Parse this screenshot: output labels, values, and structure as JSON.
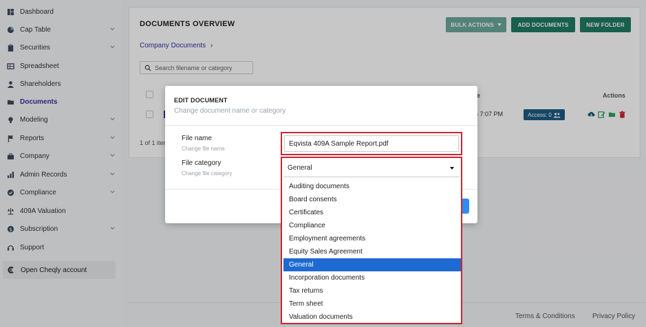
{
  "sidebar": {
    "items": [
      {
        "label": "Dashboard",
        "icon": "dashboard-icon"
      },
      {
        "label": "Cap Table",
        "icon": "pie-chart-icon"
      },
      {
        "label": "Securities",
        "icon": "clipboard-icon"
      },
      {
        "label": "Spreadsheet",
        "icon": "spreadsheet-icon"
      },
      {
        "label": "Shareholders",
        "icon": "user-icon"
      },
      {
        "label": "Documents",
        "icon": "folder-icon"
      },
      {
        "label": "Modeling",
        "icon": "bulb-icon"
      },
      {
        "label": "Reports",
        "icon": "flag-icon"
      },
      {
        "label": "Company",
        "icon": "briefcase-icon"
      },
      {
        "label": "Admin Records",
        "icon": "chart-icon"
      },
      {
        "label": "Compliance",
        "icon": "check-circle-icon"
      },
      {
        "label": "409A Valuation",
        "icon": "scale-icon"
      },
      {
        "label": "Subscription",
        "icon": "dollar-icon"
      },
      {
        "label": "Support",
        "icon": "headset-icon"
      }
    ],
    "cheqly_label": "Open Cheqly account"
  },
  "card": {
    "title": "DOCUMENTS OVERVIEW",
    "bulk_actions": "BULK ACTIONS",
    "add_documents": "ADD DOCUMENTS",
    "new_folder": "NEW FOLDER",
    "breadcrumb": "Company Documents",
    "search_placeholder": "Search filename or category",
    "header_date_fragment": "e",
    "header_actions": "Actions",
    "row_date_fragment": "6 7:07 PM",
    "access_label": "Access: 0",
    "pager_fragment": "1 of 1 item"
  },
  "footer": {
    "terms": "Terms & Conditions",
    "privacy": "Privacy Policy"
  },
  "modal": {
    "title": "EDIT DOCUMENT",
    "subtitle": "Change document name or category",
    "file_name_label": "File name",
    "file_name_hint": "Change file name",
    "file_name_value": "Eqvista 409A Sample Report.pdf",
    "file_category_label": "File category",
    "file_category_hint": "Change file category",
    "file_category_value": "General",
    "options": [
      "Auditing documents",
      "Board consents",
      "Certificates",
      "Compliance",
      "Employment agreements",
      "Equity Sales Agreement",
      "General",
      "Incorporation documents",
      "Tax returns",
      "Term sheet",
      "Valuation documents"
    ],
    "selected_option": "General"
  },
  "colors": {
    "accent": "#3a2ea8",
    "primary_button": "#1f7a64",
    "highlight_border": "#d0232f",
    "selected_option": "#1f6ad2"
  }
}
